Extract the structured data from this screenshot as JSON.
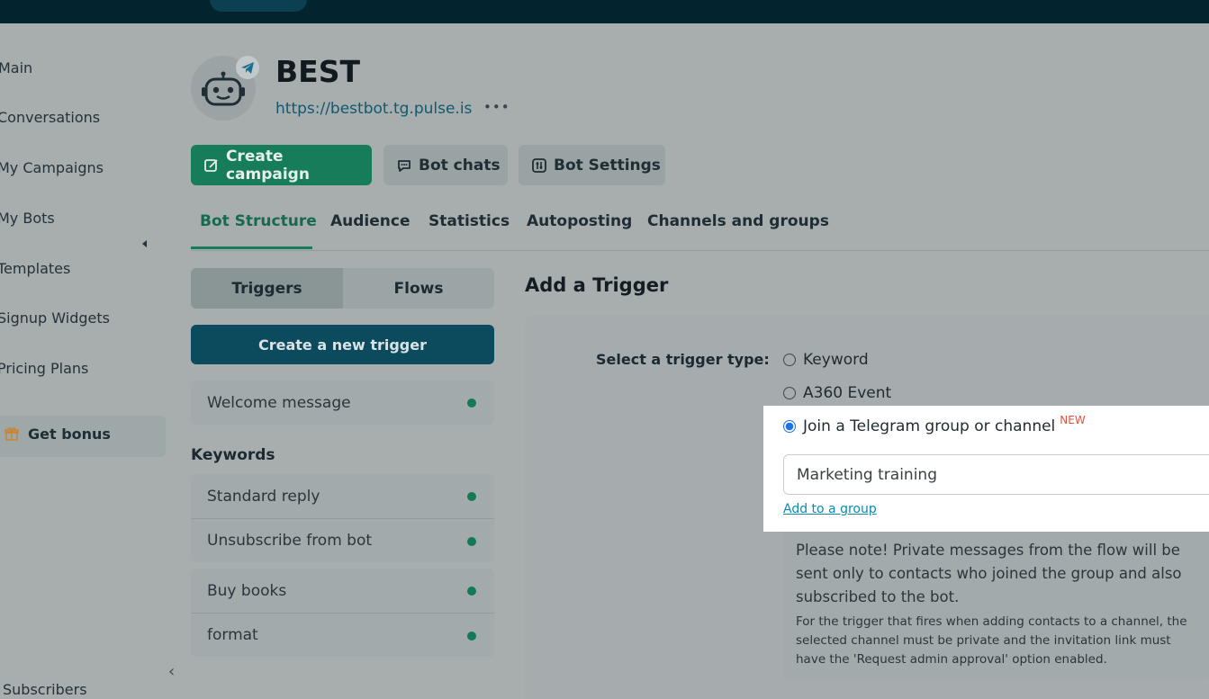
{
  "sidebar": {
    "items": [
      {
        "label": "Main"
      },
      {
        "label": "Conversations"
      },
      {
        "label": "My Campaigns"
      },
      {
        "label": "My Bots"
      },
      {
        "label": "Templates"
      },
      {
        "label": "Signup Widgets"
      },
      {
        "label": "Pricing Plans"
      }
    ],
    "bonus": "Get bonus",
    "subscribers": "Subscribers"
  },
  "bot": {
    "name": "BEST",
    "url": "https://bestbot.tg.pulse.is",
    "more": "•••"
  },
  "actions": {
    "create_campaign": "Create campaign",
    "bot_chats": "Bot chats",
    "bot_settings": "Bot Settings"
  },
  "tabs": [
    {
      "label": "Bot Structure",
      "active": true
    },
    {
      "label": "Audience"
    },
    {
      "label": "Statistics"
    },
    {
      "label": "Autoposting"
    },
    {
      "label": "Channels and groups"
    }
  ],
  "segmented": {
    "triggers": "Triggers",
    "flows": "Flows"
  },
  "create_trigger": "Create a new trigger",
  "welcome": {
    "label": "Welcome message"
  },
  "keywords": {
    "title": "Keywords",
    "group1": [
      "Standard reply",
      "Unsubscribe from bot"
    ],
    "group2": [
      "Buy books",
      "format"
    ]
  },
  "trigger_form": {
    "title": "Add a Trigger",
    "select_label": "Select a trigger type:",
    "options": [
      {
        "label": "Keyword",
        "checked": false
      },
      {
        "label": "A360 Event",
        "checked": false
      },
      {
        "label": "Join a Telegram group or channel",
        "checked": true,
        "badge": "NEW"
      }
    ],
    "group_value": "Marketing training",
    "add_link": "Add to a group",
    "note_main": "Please note! Private messages from the flow will be sent only to contacts who joined the group and also subscribed to the bot.",
    "note_small": "For the trigger that fires when adding contacts to a channel, the selected channel must be private and the invitation link must have the 'Request admin approval' option enabled."
  },
  "colors": {
    "accent_green": "#167c5a",
    "primary_teal": "#0c4a5d",
    "link": "#0a8cae",
    "badge_new": "#e2533c",
    "status_dot": "#137a55"
  }
}
